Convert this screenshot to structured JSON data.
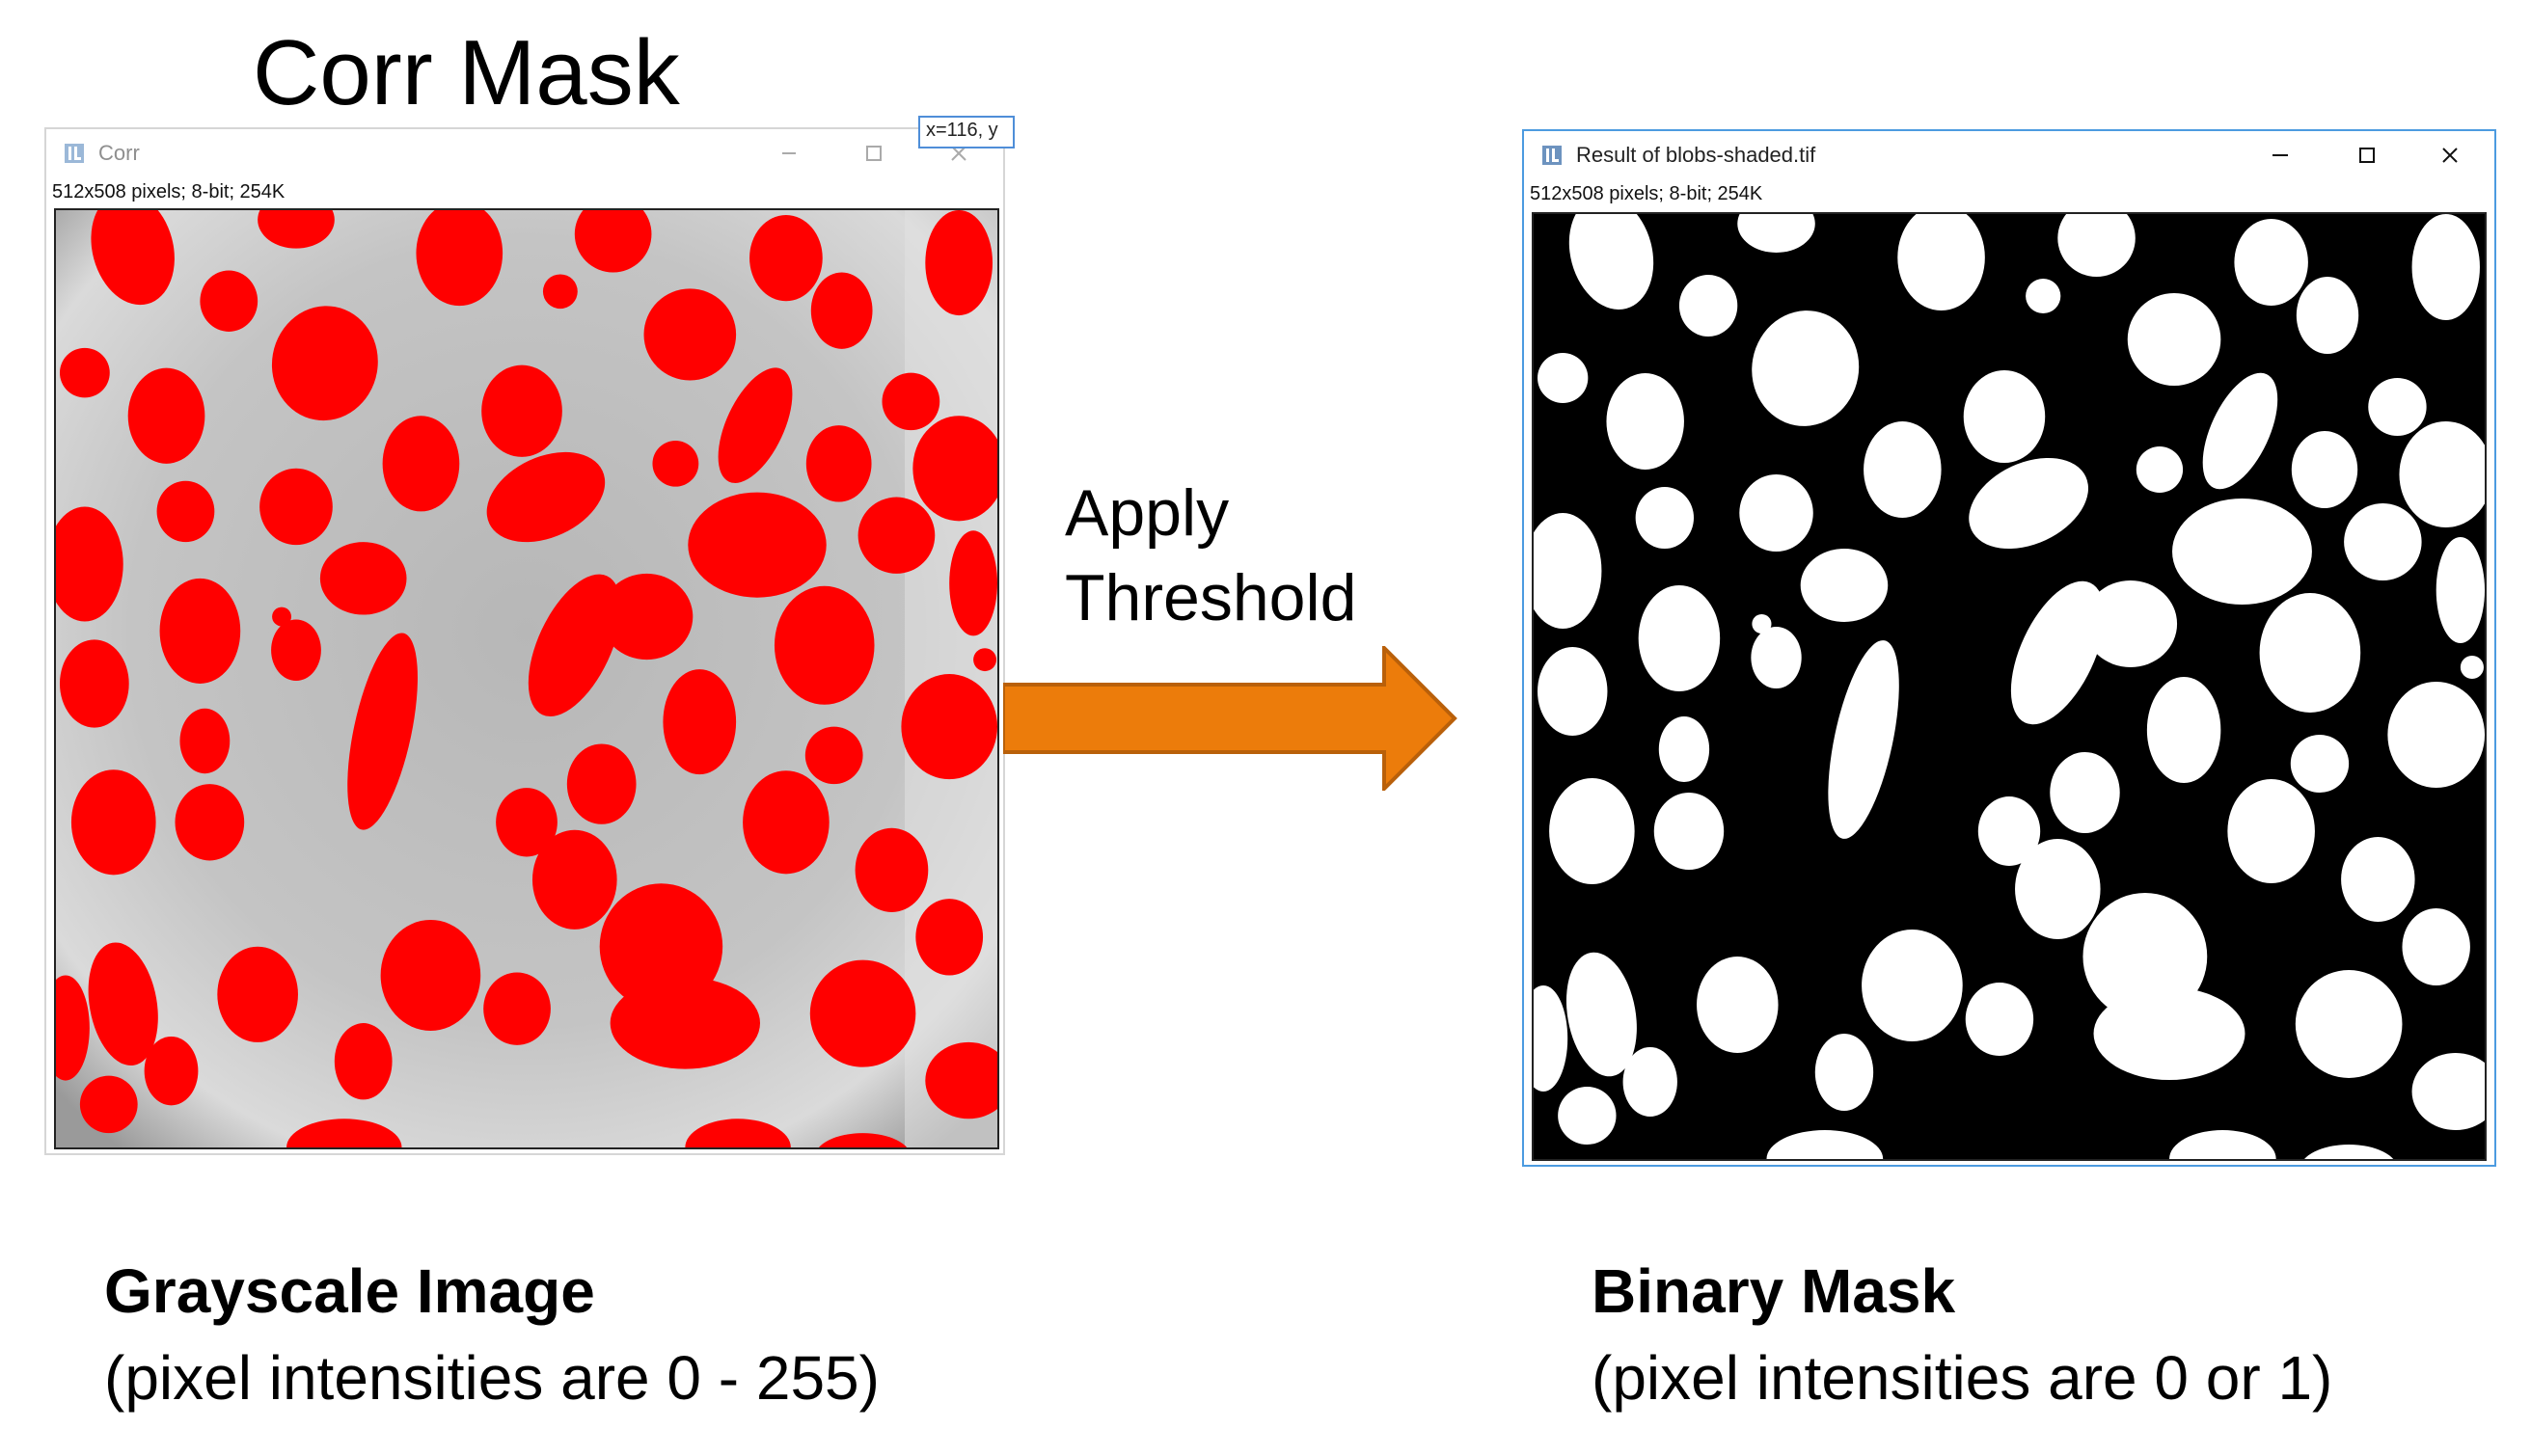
{
  "slide": {
    "title": "Corr Mask",
    "arrow_label_line1": "Apply",
    "arrow_label_line2": "Threshold",
    "arrow_color": "#ec7c0b",
    "arrow_border_color": "#b9600a"
  },
  "left_window": {
    "title": "Corr",
    "image_info": "512x508 pixels; 8-bit; 254K",
    "coordinate_tooltip": "x=116, y",
    "icon": "imagej-icon",
    "blob_color": "#ff0000"
  },
  "right_window": {
    "title": "Result of blobs-shaded.tif",
    "image_info": "512x508 pixels; 8-bit; 254K",
    "icon": "imagej-icon",
    "controls": [
      "minimize-icon",
      "maximize-icon",
      "close-icon"
    ]
  },
  "captions": {
    "left_title": "Grayscale Image",
    "left_sub": "(pixel intensities are 0 - 255)",
    "right_title": "Binary Mask",
    "right_sub": "(pixel intensities are 0 or 1)"
  }
}
